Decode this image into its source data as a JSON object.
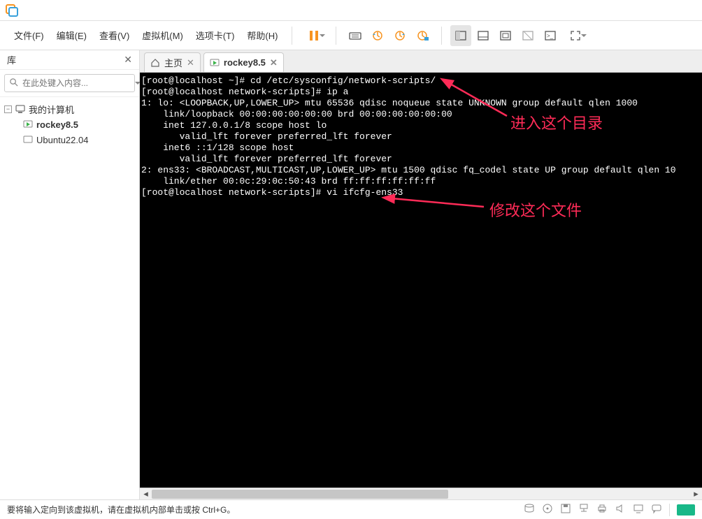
{
  "menu": {
    "file": "文件(F)",
    "edit": "编辑(E)",
    "view": "查看(V)",
    "vm": "虚拟机(M)",
    "tabs": "选项卡(T)",
    "help": "帮助(H)"
  },
  "sidebar": {
    "title": "库",
    "search_placeholder": "在此处键入内容...",
    "root": "我的计算机",
    "items": [
      "rockey8.5",
      "Ubuntu22.04"
    ]
  },
  "tabs": {
    "home": "主页",
    "active": "rockey8.5"
  },
  "terminal": {
    "lines": [
      "[root@localhost ~]# cd /etc/sysconfig/network-scripts/",
      "[root@localhost network-scripts]# ip a",
      "1: lo: <LOOPBACK,UP,LOWER_UP> mtu 65536 qdisc noqueue state UNKNOWN group default qlen 1000",
      "    link/loopback 00:00:00:00:00:00 brd 00:00:00:00:00:00",
      "    inet 127.0.0.1/8 scope host lo",
      "       valid_lft forever preferred_lft forever",
      "    inet6 ::1/128 scope host ",
      "       valid_lft forever preferred_lft forever",
      "2: ens33: <BROADCAST,MULTICAST,UP,LOWER_UP> mtu 1500 qdisc fq_codel state UP group default qlen 10",
      "    link/ether 00:0c:29:0c:50:43 brd ff:ff:ff:ff:ff:ff",
      "[root@localhost network-scripts]# vi ifcfg-ens33"
    ]
  },
  "annotations": {
    "a1": "进入这个目录",
    "a2": "修改这个文件"
  },
  "status": {
    "text": "要将输入定向到该虚拟机，请在虚拟机内部单击或按 Ctrl+G。"
  },
  "colors": {
    "accent": "#f79421",
    "pause": "#f79421",
    "anno": "#ff2b57"
  }
}
